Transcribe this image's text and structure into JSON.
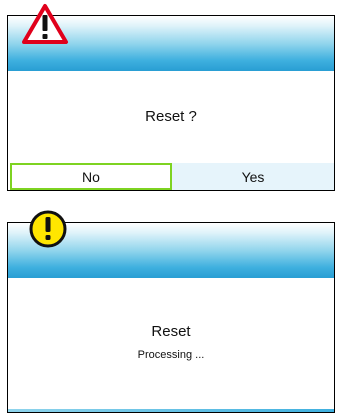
{
  "reset_confirm": {
    "message": "Reset ?",
    "buttons": {
      "no_label": "No",
      "yes_label": "Yes"
    },
    "icon": "warning-triangle-icon"
  },
  "reset_processing": {
    "title": "Reset",
    "status": "Processing ...",
    "icon": "exclamation-circle-icon"
  },
  "colors": {
    "title_bar_blue": "#3fb0df",
    "warning_red": "#e0001b",
    "alert_yellow": "#ffe600",
    "selected_button_border": "#7ed321"
  }
}
